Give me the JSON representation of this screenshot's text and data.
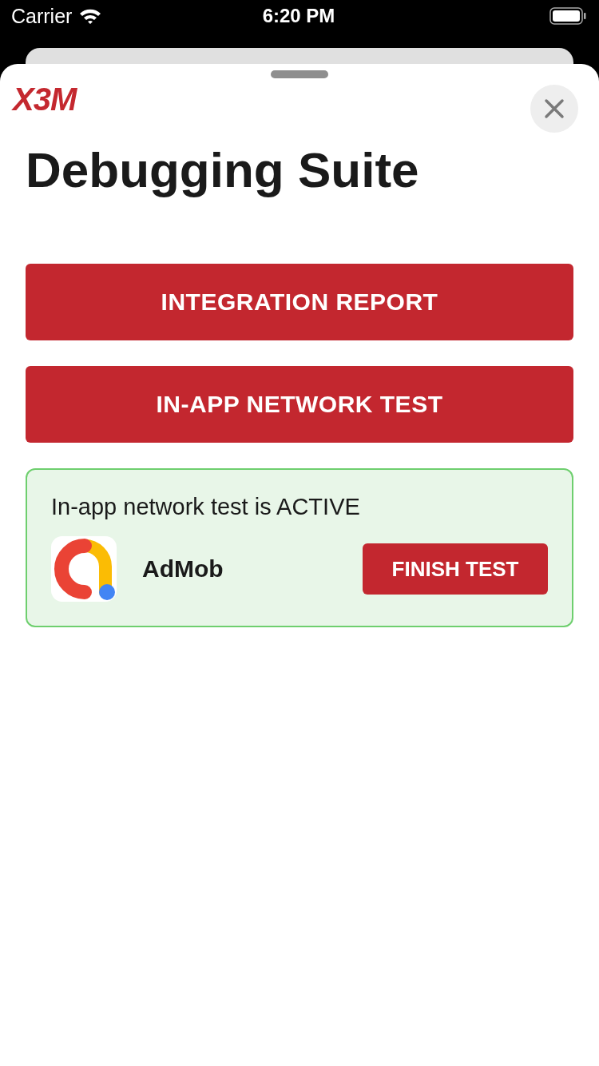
{
  "status_bar": {
    "carrier": "Carrier",
    "time": "6:20 PM"
  },
  "logo": "X3M",
  "title": "Debugging Suite",
  "buttons": [
    "INTEGRATION REPORT",
    "IN-APP NETWORK TEST"
  ],
  "test_panel": {
    "message": "In-app network test is ACTIVE",
    "network": "AdMob",
    "action": "FINISH TEST"
  }
}
